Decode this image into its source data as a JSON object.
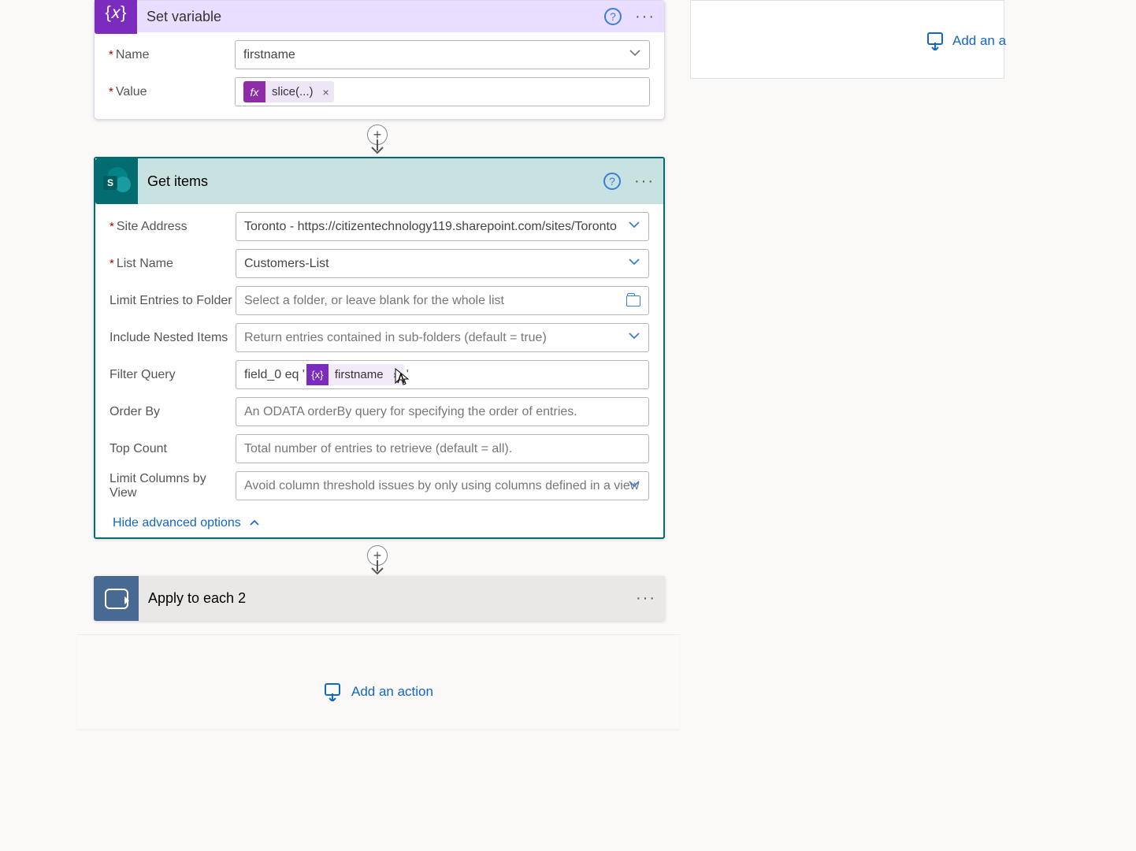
{
  "setvar": {
    "title": "Set variable",
    "name_label": "Name",
    "value_label": "Value",
    "name_value": "firstname",
    "value_token": "slice(...)"
  },
  "getitems": {
    "title": "Get items",
    "site_label": "Site Address",
    "site_value": "Toronto - https://citizentechnology119.sharepoint.com/sites/Toronto",
    "list_label": "List Name",
    "list_value": "Customers-List",
    "folder_label": "Limit Entries to Folder",
    "folder_placeholder": "Select a folder, or leave blank for the whole list",
    "nested_label": "Include Nested Items",
    "nested_placeholder": "Return entries contained in sub-folders (default = true)",
    "filter_label": "Filter Query",
    "filter_prefix": "field_0 eq '",
    "filter_token": "firstname",
    "orderby_label": "Order By",
    "orderby_placeholder": "An ODATA orderBy query for specifying the order of entries.",
    "top_label": "Top Count",
    "top_placeholder": "Total number of entries to retrieve (default = all).",
    "limitcols_label": "Limit Columns by View",
    "limitcols_placeholder": "Avoid column threshold issues by only using columns defined in a view",
    "hide_adv": "Hide advanced options"
  },
  "apply": {
    "title": "Apply to each 2"
  },
  "add_action": "Add an action",
  "right_add": "Add an a",
  "icons": {
    "help": "?",
    "remove": "×",
    "var_badge": "{x}",
    "fx_badge": "fx"
  }
}
